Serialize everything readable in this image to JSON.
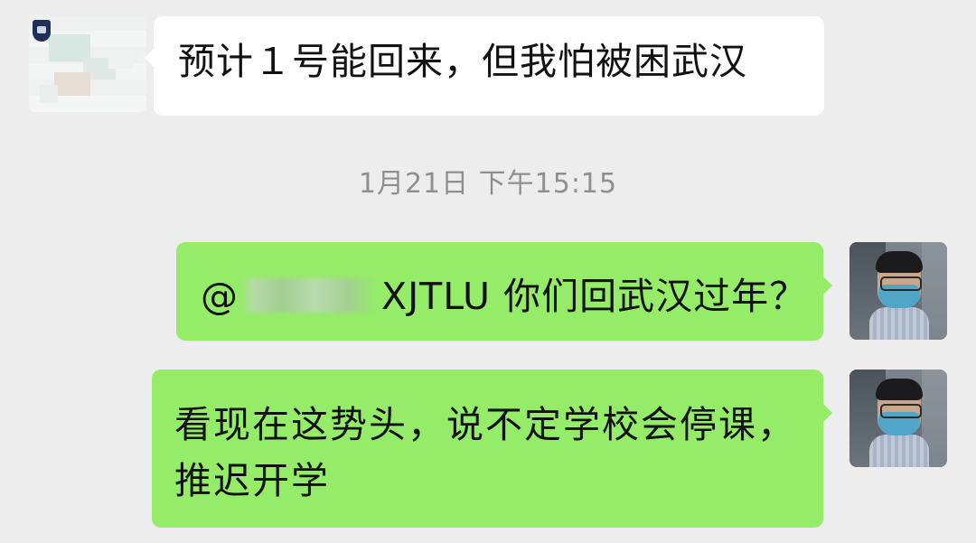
{
  "messages": [
    {
      "side": "left",
      "text": "预计１号能回来，但我怕被困武汉"
    },
    {
      "side": "right",
      "mention_prefix": "@",
      "text": "XJTLU  你们回武汉过年？"
    },
    {
      "side": "right",
      "text": "看现在这势头，说不定学校会停课，推迟开学"
    }
  ],
  "timestamp": "1月21日 下午15:15",
  "colors": {
    "background": "#ededed",
    "incoming_bubble": "#ffffff",
    "outgoing_bubble": "#95ec69",
    "timestamp_text": "#8f8f8f"
  },
  "icons": {
    "left_avatar": "blurred-contact-avatar-icon",
    "right_avatar": "user-photo-avatar-icon"
  }
}
